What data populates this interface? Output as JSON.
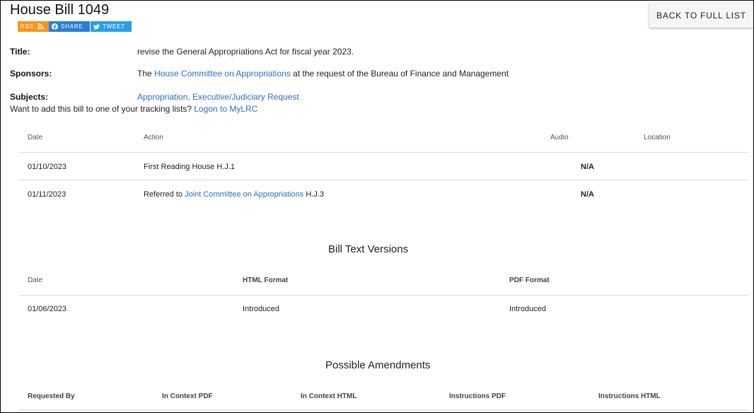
{
  "header": {
    "title": "House Bill 1049",
    "back_label": "BACK TO FULL LIST"
  },
  "social": {
    "rss": "RSS",
    "share": "SHARE",
    "tweet": "TWEET"
  },
  "info": {
    "title_label": "Title:",
    "title_value": "revise the General Appropriations Act for fiscal year 2023.",
    "sponsors_label": "Sponsors:",
    "sponsors_prefix": "The",
    "sponsors_link": "House Committee on Appropriations",
    "sponsors_suffix": "at the request of the Bureau of Finance and Management",
    "subjects_label": "Subjects:",
    "subjects_link": "Appropriation, Executive/Judiciary Request",
    "tracking_text": "Want to add this bill to one of your tracking lists?",
    "tracking_link": "Logon to MyLRC"
  },
  "actions": {
    "headers": [
      "Date",
      "Action",
      "Audio",
      "Location"
    ],
    "rows": [
      {
        "date": "01/10/2023",
        "action": "First Reading House H.J.1",
        "audio": "N/A"
      },
      {
        "date": "01/11/2023",
        "action_prefix": "Referred to",
        "action_link": "Joint Committee on Appropriations",
        "action_suffix": "H.J.3",
        "audio": "N/A"
      }
    ]
  },
  "text_versions": {
    "title": "Bill Text Versions",
    "headers": [
      "Date",
      "HTML Format",
      "PDF Format"
    ],
    "rows": [
      {
        "date": "01/06/2023",
        "html": "Introduced",
        "pdf": "Introduced"
      }
    ]
  },
  "amendments": {
    "title": "Possible Amendments",
    "headers": [
      "Requested By",
      "In Context PDF",
      "In Context HTML",
      "Instructions PDF",
      "Instructions HTML"
    ]
  },
  "colors": {
    "link": "#2c6fc4",
    "rss": "#f7941d",
    "share": "#2a7fd4",
    "tweet": "#2a9fe8"
  },
  "icons": {
    "rss": "rss-icon",
    "share": "facebook-icon",
    "tweet": "twitter-icon"
  }
}
